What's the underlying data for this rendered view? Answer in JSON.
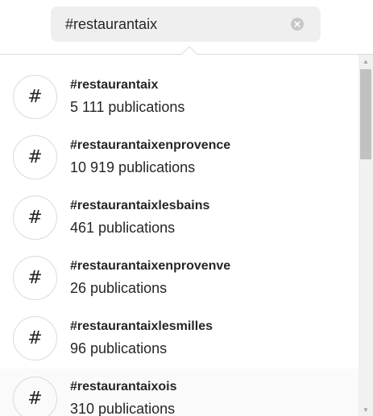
{
  "search": {
    "value": "#restaurantaix",
    "clear_icon": "close-circle-icon"
  },
  "results": [
    {
      "name": "#restaurantaix",
      "count": "5 111 publications",
      "icon": "#"
    },
    {
      "name": "#restaurantaixenprovence",
      "count": "10 919 publications",
      "icon": "#"
    },
    {
      "name": "#restaurantaixlesbains",
      "count": "461 publications",
      "icon": "#"
    },
    {
      "name": "#restaurantaixenprovenve",
      "count": "26 publications",
      "icon": "#"
    },
    {
      "name": "#restaurantaixlesmilles",
      "count": "96 publications",
      "icon": "#"
    },
    {
      "name": "#restaurantaixois",
      "count": "310 publications",
      "icon": "#"
    }
  ],
  "scrollbar": {
    "up_icon": "▲",
    "down_icon": "▼",
    "position": 0
  }
}
